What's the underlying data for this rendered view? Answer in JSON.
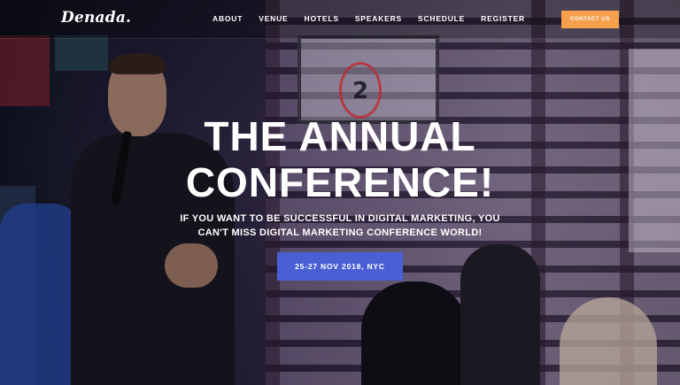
{
  "header": {
    "logo": "Denada.",
    "nav_items": [
      "ABOUT",
      "VENUE",
      "HOTELS",
      "SPEAKERS",
      "SCHEDULE",
      "REGISTER"
    ],
    "contact_label": "CONTACT US"
  },
  "hero": {
    "headline_line1": "THE ANNUAL",
    "headline_line2": "CONFERENCE!",
    "sub_line1": "IF YOU WANT TO BE SUCCESSFUL IN DIGITAL MARKETING, YOU",
    "sub_line2": "CAN'T MISS DIGITAL MARKETING CONFERENCE WORLD!",
    "date_label": "25-27 NOV 2018, NYC",
    "stage_number": "2"
  },
  "colors": {
    "accent_orange": "#f6a04d",
    "accent_blue": "#4b5fd4",
    "text": "#ffffff"
  }
}
